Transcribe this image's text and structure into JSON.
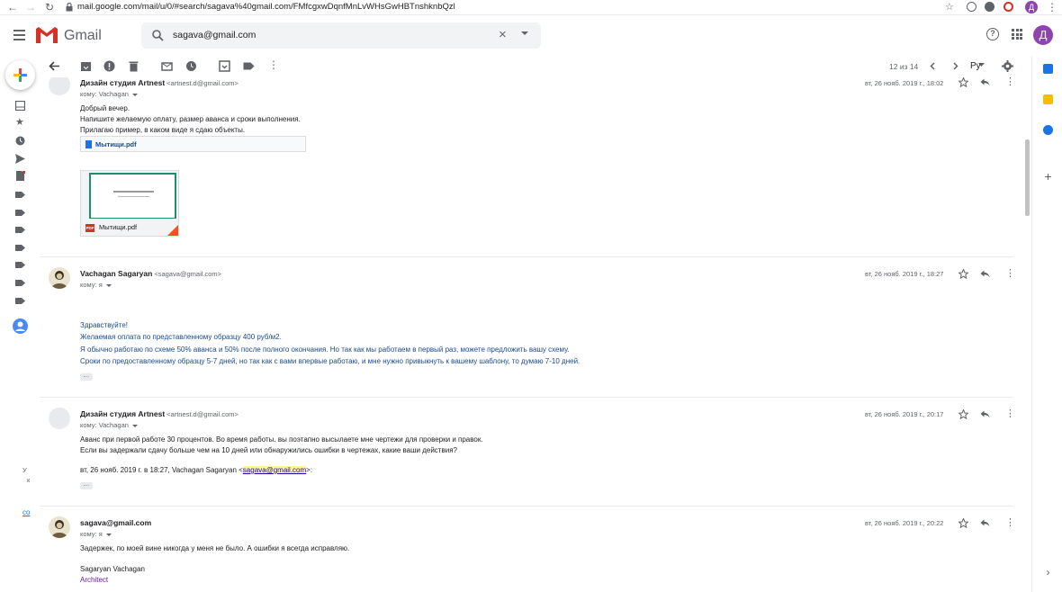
{
  "browser": {
    "url": "mail.google.com/mail/u/0/#search/sagava%40gmail.com/FMfcgxwDqnfMnLvWHsGwHBTnshknbQzl",
    "profile_initial": "Д"
  },
  "header": {
    "app_name": "Gmail",
    "search_value": "sagava@gmail.com",
    "account_initial": "Д"
  },
  "toolbar": {
    "pager": "12 из 14",
    "language": "Ру"
  },
  "sidebar": {
    "note_1": "У",
    "note_2": "к",
    "link": "co"
  },
  "messages": [
    {
      "sender": "Дизайн студия Artnest",
      "email": "<artnest.d@gmail.com>",
      "to": "кому: Vachagan",
      "date": "вт, 26 нояб. 2019 г., 18:02",
      "lines": [
        "Добрый вечер.",
        "Напишите желаемую оплату, размер аванса и сроки выполнения.",
        "Прилагаю пример, в каком виде я сдаю объекты."
      ],
      "attachment_name": "Мытищи.pdf",
      "thumb_name": "Мытищи.pdf"
    },
    {
      "sender": "Vachagan Sagaryan",
      "email": "<sagava@gmail.com>",
      "to": "кому: я",
      "date": "вт, 26 нояб. 2019 г., 18:27",
      "lines": [
        "Здравствуйте!",
        "Желаемая оплата по представленному образцу 400 руб/м2.",
        "Я обычно работаю по схеме 50% аванса и 50% после полного окончания. Но так как мы работаем в первый раз, можете предложить вашу схему.",
        "Сроки  по предоставленному образцу 5-7 дней, но так как с вами впервые работаю, и мне нужно привыкнуть к вашему шаблону, то думаю 7-10 дней."
      ]
    },
    {
      "sender": "Дизайн студия Artnest",
      "email": "<artnest.d@gmail.com>",
      "to": "кому: Vachagan",
      "date": "вт, 26 нояб. 2019 г., 20:17",
      "lines": [
        "Аванс при первой работе 30 процентов. Во время работы. вы поэтапно высылаете  мне чертежи для проверки и правок.",
        "Если вы задержали сдачу больше чем на 10 дней или обнаружились ошибки в чертежах, какие ваши действия?"
      ],
      "quote_prefix": "вт, 26 нояб. 2019 г. в 18:27, Vachagan Sagaryan <",
      "quote_email": "sagava@gmail.com",
      "quote_suffix": ">:"
    },
    {
      "sender": "sagava@gmail.com",
      "email": "",
      "to": "кому: я",
      "date": "вт, 26 нояб. 2019 г., 20:22",
      "lines": [
        "Задержек, по моей вине никогда у меня не было. А ошибки я всегда исправляю."
      ],
      "signature_name": "Sagaryan Vachagan",
      "signature_title": "Architect"
    }
  ],
  "colors": {
    "accent": "#1a73e8",
    "account": "#8e44ad",
    "body_blue": "#1a4b8c"
  }
}
